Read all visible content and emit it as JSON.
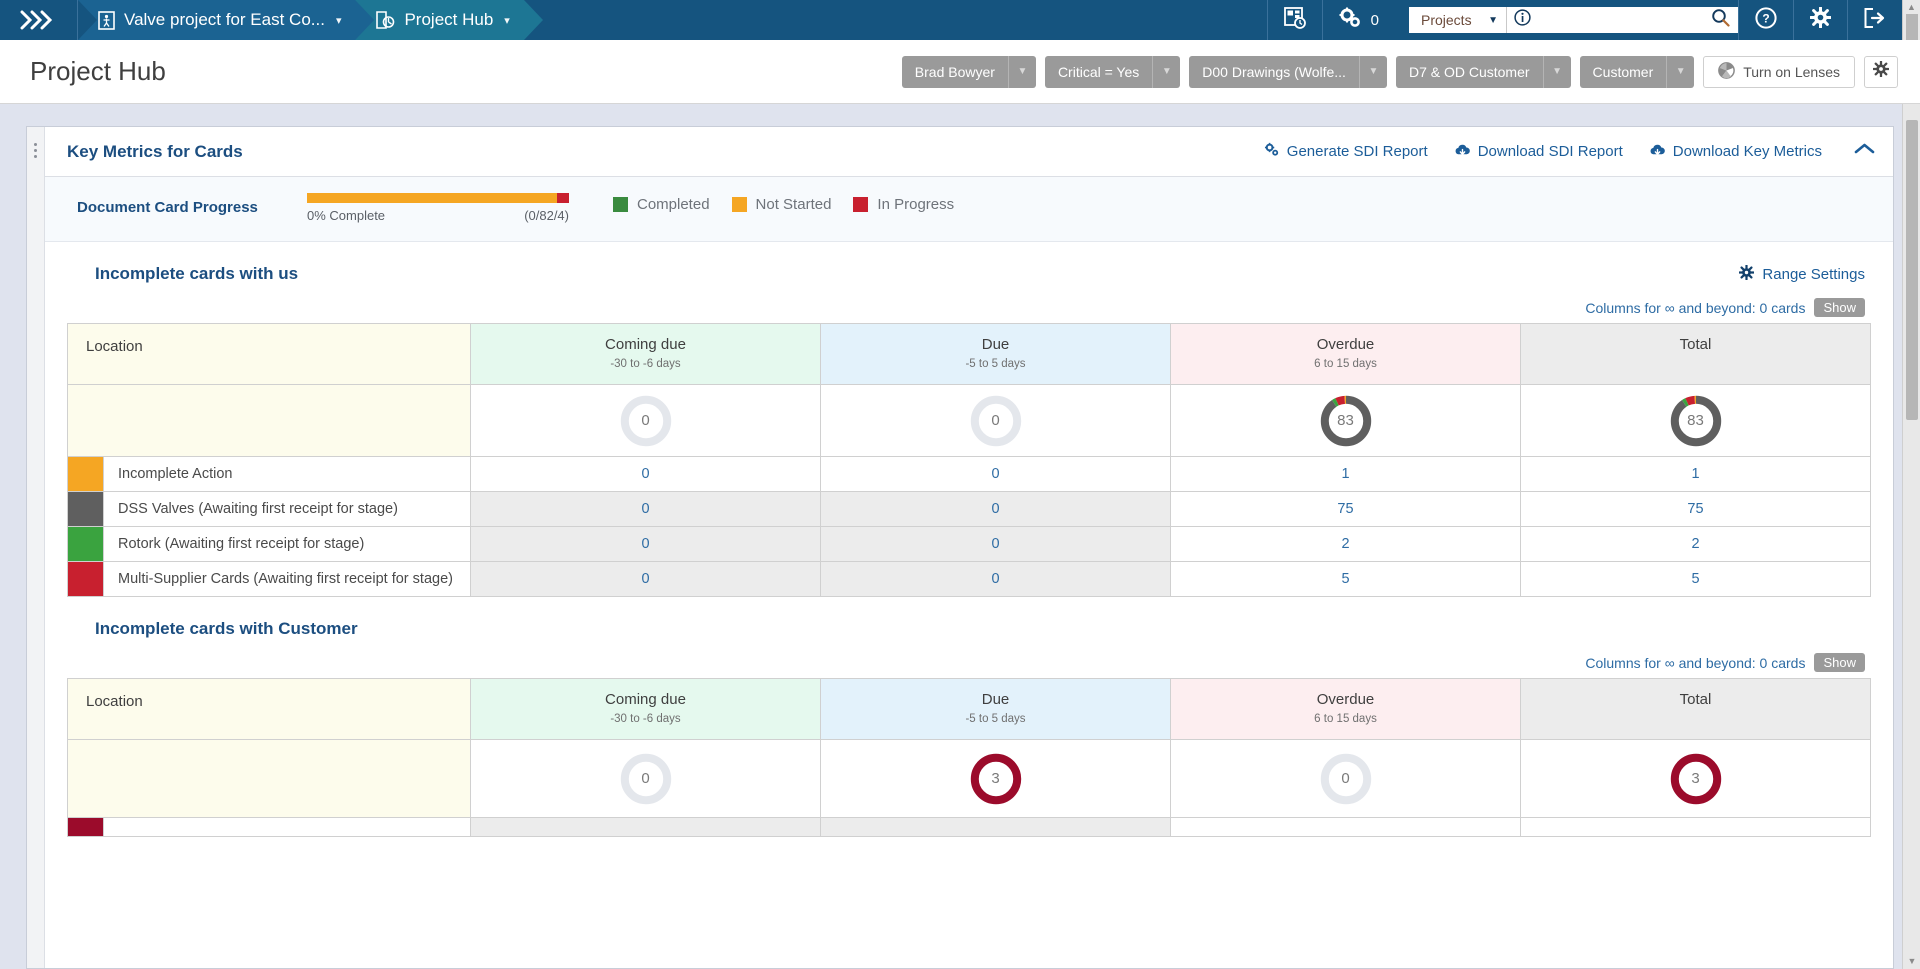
{
  "topnav": {
    "logo_name": "app-logo",
    "breadcrumbs": [
      {
        "label": "Valve project for East Co...",
        "icon": "project-document-icon"
      },
      {
        "label": "Project Hub",
        "icon": "project-hub-icon"
      }
    ],
    "dashboard_icon": "dashboard-clock-icon",
    "gears_icon": "gears-icon",
    "gears_count": "0",
    "project_select": "Projects",
    "info_icon": "info-icon",
    "search_value": "",
    "search_placeholder": "",
    "search_icon": "search-icon",
    "help_icon": "help-icon",
    "settings_icon": "gear-icon",
    "logout_icon": "logout-icon"
  },
  "header": {
    "title": "Project Hub",
    "filters": [
      {
        "label": "Brad Bowyer"
      },
      {
        "label": "Critical = Yes"
      },
      {
        "label": "D00 Drawings (Wolfe..."
      },
      {
        "label": "D7 & OD Customer"
      },
      {
        "label": "Customer"
      }
    ],
    "lenses_button": "Turn on Lenses",
    "lenses_icon": "lens-aperture-icon",
    "settings_icon": "gear-icon"
  },
  "panel": {
    "title": "Key Metrics for Cards",
    "actions": [
      {
        "label": "Generate SDI Report",
        "icon": "gears-icon"
      },
      {
        "label": "Download SDI Report",
        "icon": "cloud-download-icon"
      },
      {
        "label": "Download Key Metrics",
        "icon": "cloud-download-icon"
      }
    ],
    "collapse_icon": "chevron-up-icon"
  },
  "progress": {
    "label": "Document Card Progress",
    "percent_text": "0% Complete",
    "counts_text": "(0/82/4)",
    "segments": [
      {
        "name": "Not Started",
        "color": "#f5a623",
        "pct": 95.3
      },
      {
        "name": "In Progress",
        "color": "#c8202f",
        "pct": 4.7
      }
    ],
    "legend": [
      {
        "label": "Completed",
        "color": "#3a8b3f"
      },
      {
        "label": "Not Started",
        "color": "#f5a623"
      },
      {
        "label": "In Progress",
        "color": "#c8202f"
      }
    ]
  },
  "sections": [
    {
      "title": "Incomplete cards with us",
      "range_settings_label": "Range Settings",
      "range_settings_icon": "gear-icon",
      "columns_note": "Columns for ∞ and beyond: 0 cards",
      "show_label": "Show",
      "columns": [
        {
          "name": "Location",
          "sub": ""
        },
        {
          "name": "Coming due",
          "sub": "-30 to -6 days"
        },
        {
          "name": "Due",
          "sub": "-5 to 5 days"
        },
        {
          "name": "Overdue",
          "sub": "6 to 15 days"
        },
        {
          "name": "Total",
          "sub": ""
        }
      ],
      "donuts": [
        {
          "value": "0",
          "slices": [
            {
              "color": "#e4e7ec",
              "pct": 100
            }
          ]
        },
        {
          "value": "0",
          "slices": [
            {
              "color": "#e4e7ec",
              "pct": 100
            }
          ]
        },
        {
          "value": "83",
          "slices": [
            {
              "color": "#5f5f5f",
              "pct": 90.4
            },
            {
              "color": "#3aa33f",
              "pct": 2.4
            },
            {
              "color": "#c8202f",
              "pct": 6.0
            },
            {
              "color": "#f5a623",
              "pct": 1.2
            }
          ]
        },
        {
          "value": "83",
          "slices": [
            {
              "color": "#5f5f5f",
              "pct": 90.4
            },
            {
              "color": "#3aa33f",
              "pct": 2.4
            },
            {
              "color": "#c8202f",
              "pct": 6.0
            },
            {
              "color": "#f5a623",
              "pct": 1.2
            }
          ]
        }
      ],
      "rows": [
        {
          "swatch": "#f5a623",
          "name": "Incomplete Action",
          "values": [
            "0",
            "0",
            "1",
            "1"
          ]
        },
        {
          "swatch": "#5f5f5f",
          "name": "DSS Valves (Awaiting first receipt for stage)",
          "values": [
            "0",
            "0",
            "75",
            "75"
          ]
        },
        {
          "swatch": "#3aa33f",
          "name": "Rotork (Awaiting first receipt for stage)",
          "values": [
            "0",
            "0",
            "2",
            "2"
          ]
        },
        {
          "swatch": "#c8202f",
          "name": "Multi-Supplier Cards (Awaiting first receipt for stage)",
          "values": [
            "0",
            "0",
            "5",
            "5"
          ]
        }
      ]
    },
    {
      "title": "Incomplete cards with Customer",
      "range_settings_label": "",
      "columns_note": "Columns for ∞ and beyond: 0 cards",
      "show_label": "Show",
      "columns": [
        {
          "name": "Location",
          "sub": ""
        },
        {
          "name": "Coming due",
          "sub": "-30 to -6 days"
        },
        {
          "name": "Due",
          "sub": "-5 to 5 days"
        },
        {
          "name": "Overdue",
          "sub": "6 to 15 days"
        },
        {
          "name": "Total",
          "sub": ""
        }
      ],
      "donuts": [
        {
          "value": "0",
          "slices": [
            {
              "color": "#e4e7ec",
              "pct": 100
            }
          ]
        },
        {
          "value": "3",
          "slices": [
            {
              "color": "#9b0b2b",
              "pct": 100
            }
          ]
        },
        {
          "value": "0",
          "slices": [
            {
              "color": "#e4e7ec",
              "pct": 100
            }
          ]
        },
        {
          "value": "3",
          "slices": [
            {
              "color": "#9b0b2b",
              "pct": 100
            }
          ]
        }
      ],
      "rows": [
        {
          "swatch": "#9b0b2b",
          "name": "",
          "values": [
            "",
            "",
            "",
            ""
          ]
        }
      ]
    }
  ],
  "colors": {
    "navy": "#15547f",
    "accent_link": "#1c5d99",
    "page_bg": "#dfe3ee"
  }
}
